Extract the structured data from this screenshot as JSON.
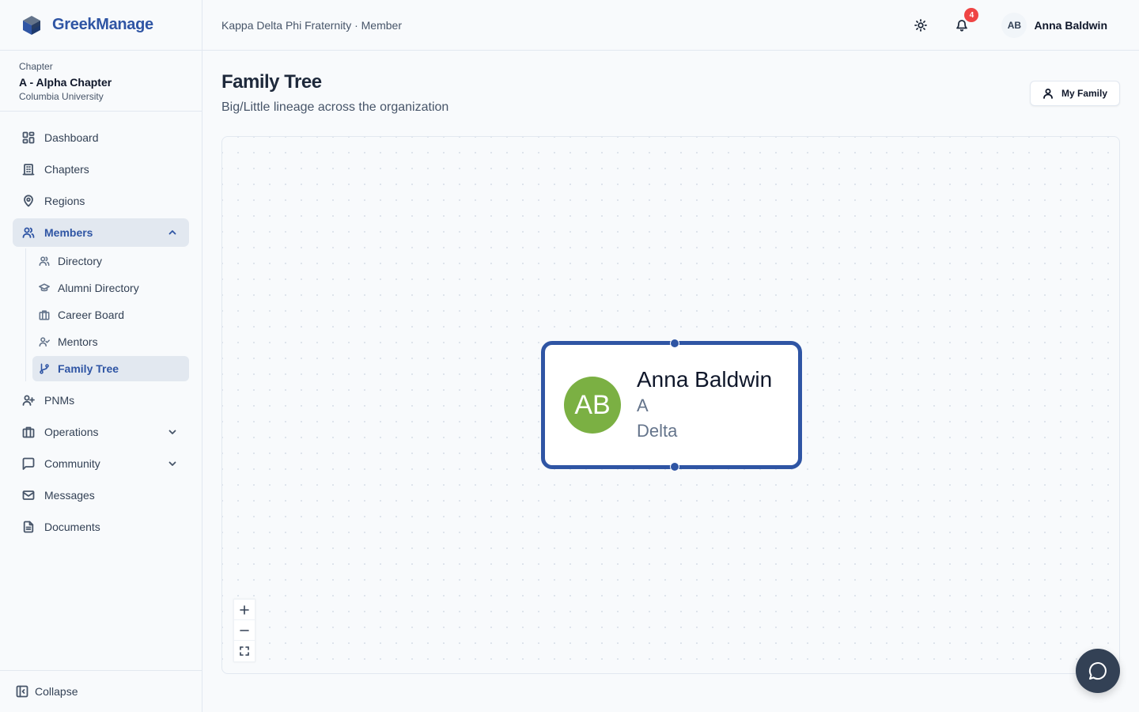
{
  "brand": {
    "name": "GreekManage",
    "accent": "#2f55a4"
  },
  "chapter": {
    "label": "Chapter",
    "name": "A - Alpha Chapter",
    "school": "Columbia University"
  },
  "sidebar": {
    "items": [
      {
        "label": "Dashboard",
        "icon": "dashboard-icon"
      },
      {
        "label": "Chapters",
        "icon": "building-icon"
      },
      {
        "label": "Regions",
        "icon": "map-pin-icon"
      },
      {
        "label": "Members",
        "icon": "users-icon",
        "expanded": true
      },
      {
        "label": "PNMs",
        "icon": "user-plus-icon"
      },
      {
        "label": "Operations",
        "icon": "briefcase-icon"
      },
      {
        "label": "Community",
        "icon": "message-square-icon"
      },
      {
        "label": "Messages",
        "icon": "mail-icon"
      },
      {
        "label": "Documents",
        "icon": "file-text-icon"
      }
    ],
    "members_sub": [
      {
        "label": "Directory",
        "icon": "users-icon"
      },
      {
        "label": "Alumni Directory",
        "icon": "graduation-cap-icon"
      },
      {
        "label": "Career Board",
        "icon": "briefcase-icon"
      },
      {
        "label": "Mentors",
        "icon": "user-check-icon"
      },
      {
        "label": "Family Tree",
        "icon": "git-branch-icon",
        "active": true
      }
    ],
    "collapse_label": "Collapse"
  },
  "header": {
    "org": "Kappa Delta Phi Fraternity · Member",
    "notifications": "4",
    "user_initials": "AB",
    "user_name": "Anna Baldwin"
  },
  "page": {
    "title": "Family Tree",
    "subtitle": "Big/Little lineage across the organization",
    "my_family_label": "My Family"
  },
  "tree": {
    "node": {
      "initials": "AB",
      "name": "Anna Baldwin",
      "line1": "A",
      "line2": "Delta",
      "avatar_color": "#7bb043",
      "border_color": "#2f55a4"
    },
    "controls": [
      "zoom-in",
      "zoom-out",
      "fit-view"
    ]
  }
}
